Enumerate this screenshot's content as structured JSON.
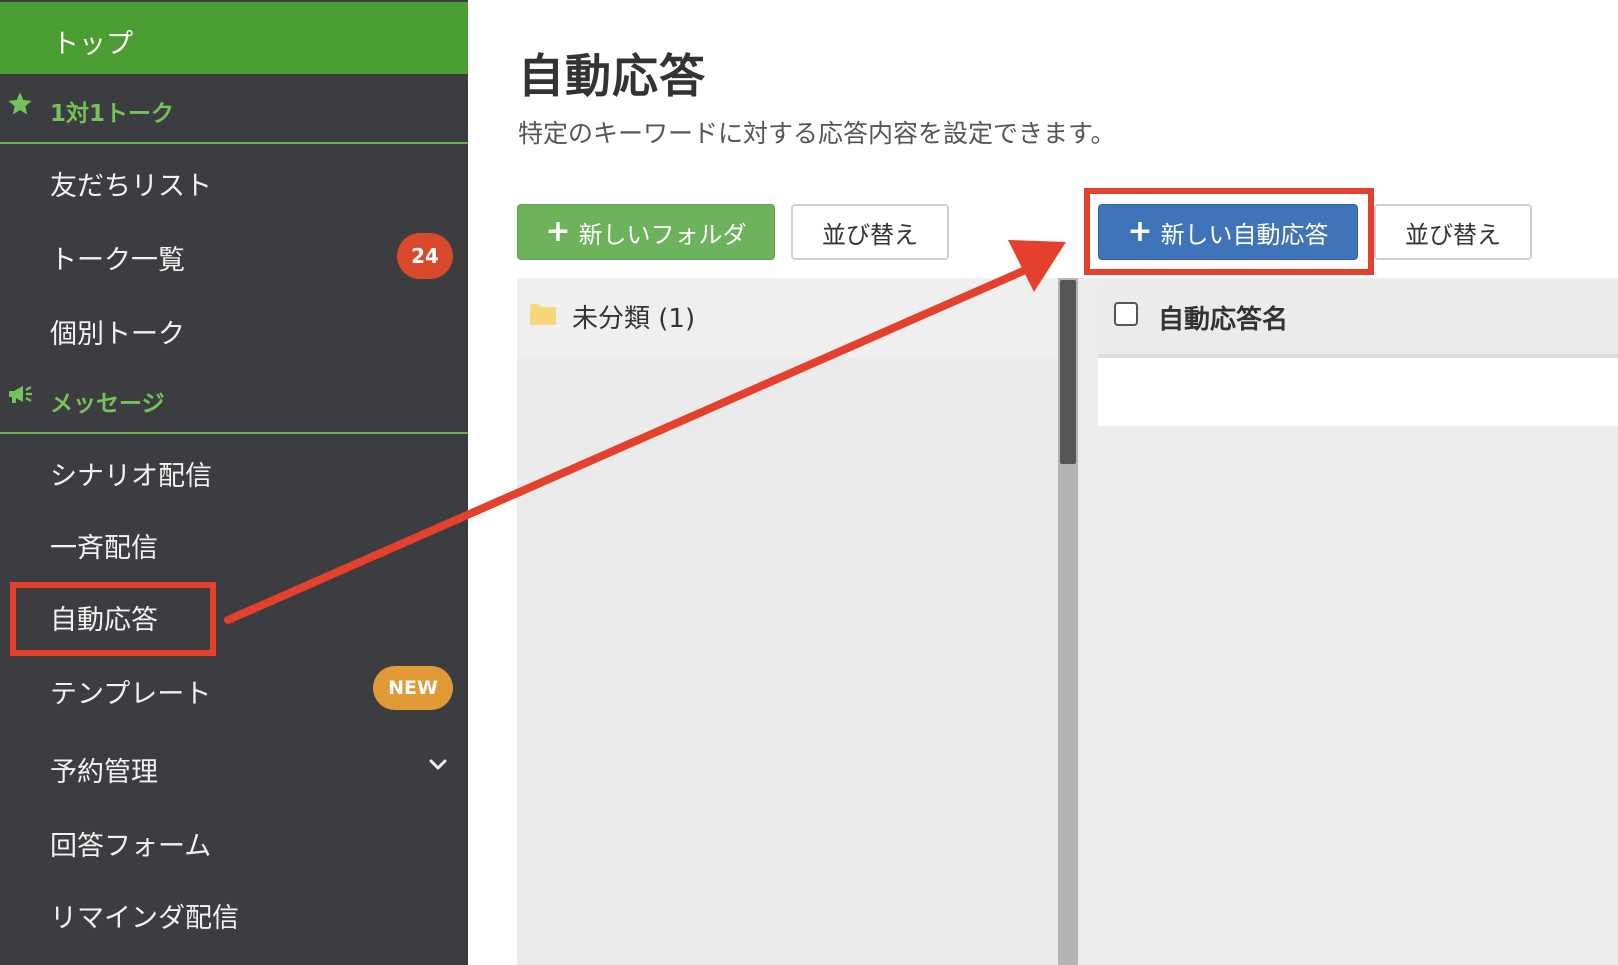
{
  "sidebar": {
    "top": "トップ",
    "sections": [
      {
        "label": "1対1トーク",
        "icon": "star-icon"
      },
      {
        "label": "メッセージ",
        "icon": "megaphone-icon"
      }
    ],
    "talk_items": [
      {
        "label": "友だちリスト"
      },
      {
        "label": "トーク一覧",
        "badge": "24"
      },
      {
        "label": "個別トーク"
      }
    ],
    "message_items": [
      {
        "label": "シナリオ配信"
      },
      {
        "label": "一斉配信"
      },
      {
        "label": "自動応答",
        "highlighted": true
      },
      {
        "label": "テンプレート",
        "badge": "NEW"
      },
      {
        "label": "予約管理",
        "icon": "chevron-down-icon"
      },
      {
        "label": "回答フォーム"
      },
      {
        "label": "リマインダ配信"
      }
    ]
  },
  "main": {
    "title": "自動応答",
    "description": "特定のキーワードに対する応答内容を設定できます。",
    "buttons": {
      "new_folder": "新しいフォルダ",
      "sort_folders": "並び替え",
      "new_auto_reply": "新しい自動応答",
      "sort_replies": "並び替え"
    },
    "folders": [
      {
        "label": "未分類 (1)",
        "icon": "folder-icon"
      }
    ],
    "list": {
      "column_name": "自動応答名"
    }
  },
  "colors": {
    "sidebar_bg": "#3c3d40",
    "top_active": "#4a9d31",
    "section_green": "#77c15a",
    "badge_red": "#d9492c",
    "badge_orange": "#e09a36",
    "button_green": "#6cb35c",
    "button_blue": "#3f74b8",
    "annotation_red": "#e4402b"
  }
}
